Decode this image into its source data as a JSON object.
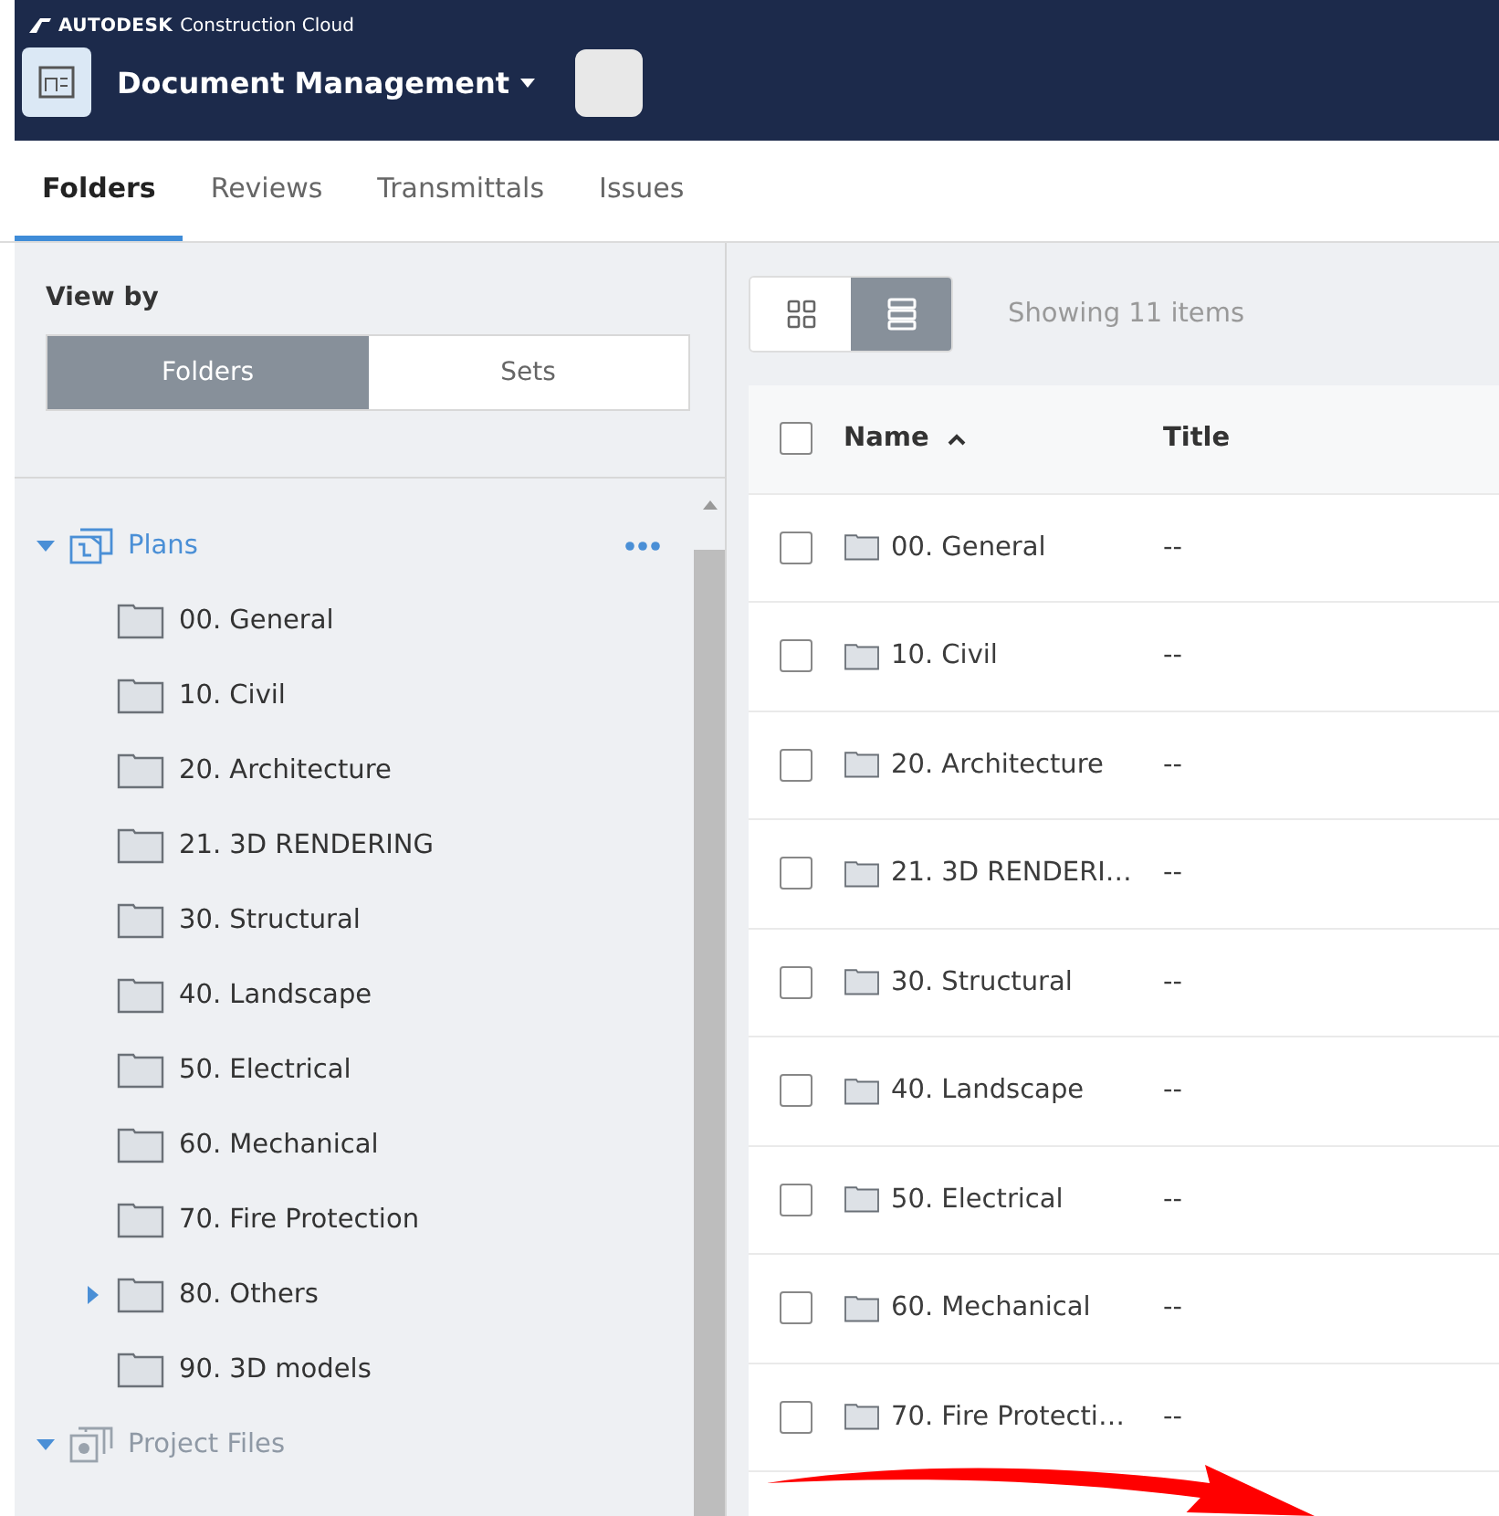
{
  "brand": {
    "logo": "AUTODESK",
    "product": "Construction Cloud"
  },
  "module": {
    "title": "Document Management"
  },
  "tabs": [
    {
      "label": "Folders",
      "selected": true
    },
    {
      "label": "Reviews",
      "selected": false
    },
    {
      "label": "Transmittals",
      "selected": false
    },
    {
      "label": "Issues",
      "selected": false
    }
  ],
  "sidebar": {
    "view_by_label": "View by",
    "view_options": [
      {
        "label": "Folders",
        "selected": true
      },
      {
        "label": "Sets",
        "selected": false
      }
    ],
    "tree": [
      {
        "label": "Plans",
        "kind": "root",
        "expanded": true,
        "disabled": false,
        "children": [
          {
            "label": "00. General",
            "kind": "folder"
          },
          {
            "label": "10. Civil",
            "kind": "folder"
          },
          {
            "label": "20. Architecture",
            "kind": "folder"
          },
          {
            "label": "21. 3D RENDERING",
            "kind": "folder"
          },
          {
            "label": "30. Structural",
            "kind": "folder"
          },
          {
            "label": "40. Landscape",
            "kind": "folder"
          },
          {
            "label": "50. Electrical",
            "kind": "folder"
          },
          {
            "label": "60. Mechanical",
            "kind": "folder"
          },
          {
            "label": "70. Fire Protection",
            "kind": "folder"
          },
          {
            "label": "80. Others",
            "kind": "folder",
            "expanded": false
          },
          {
            "label": "90. 3D models",
            "kind": "folder"
          }
        ]
      },
      {
        "label": "Project Files",
        "kind": "root",
        "expanded": true,
        "disabled": true
      }
    ]
  },
  "toolbar": {
    "view_modes": [
      {
        "kind": "grid",
        "selected": false
      },
      {
        "kind": "list",
        "selected": true
      }
    ],
    "count": "Showing 11 items"
  },
  "table": {
    "select_all_checked": false,
    "columns": [
      {
        "label": "Name",
        "sorted_ascending": true
      },
      {
        "label": "Title"
      }
    ],
    "rows": [
      {
        "name": "00. General",
        "title": "--",
        "checked": false
      },
      {
        "name": "10. Civil",
        "title": "--",
        "checked": false
      },
      {
        "name": "20. Architecture",
        "title": "--",
        "checked": false
      },
      {
        "name": "21. 3D RENDERI…",
        "title": "--",
        "checked": false
      },
      {
        "name": "30. Structural",
        "title": "--",
        "checked": false
      },
      {
        "name": "40. Landscape",
        "title": "--",
        "checked": false
      },
      {
        "name": "50. Electrical",
        "title": "--",
        "checked": false
      },
      {
        "name": "60. Mechanical",
        "title": "--",
        "checked": false
      },
      {
        "name": "70. Fire Protecti…",
        "title": "--",
        "checked": false
      }
    ]
  }
}
